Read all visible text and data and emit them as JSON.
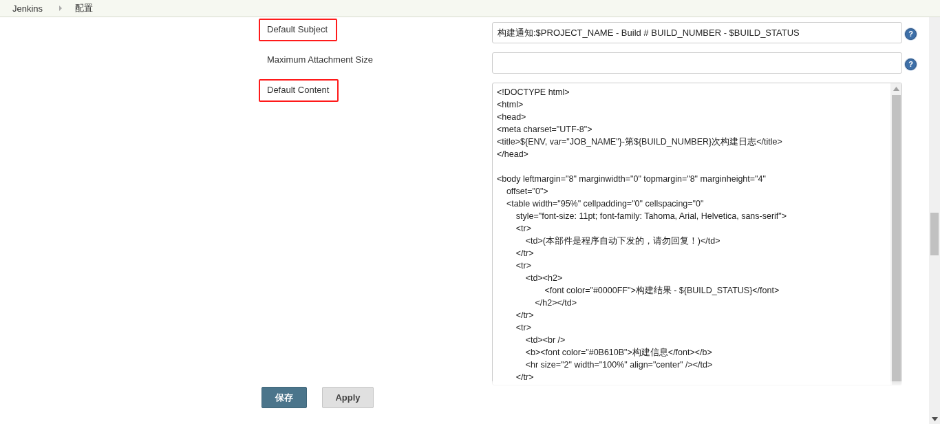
{
  "breadcrumb": [
    "Jenkins",
    "配置"
  ],
  "fields": [
    {
      "kind": "text",
      "label": "Default Subject",
      "highlighted": true,
      "value": "构建通知:$PROJECT_NAME - Build # BUILD_NUMBER - $BUILD_STATUS",
      "help": "?"
    },
    {
      "kind": "text",
      "label": "Maximum Attachment Size",
      "highlighted": false,
      "help": "?"
    },
    {
      "kind": "textarea",
      "label": "Default Content",
      "highlighted": true,
      "value": "<!DOCTYPE html>\n<html>\n<head>\n<meta charset=\"UTF-8\">\n<title>${ENV, var=\"JOB_NAME\"}-第${BUILD_NUMBER}次构建日志</title>\n</head>\n\n<body leftmargin=\"8\" marginwidth=\"0\" topmargin=\"8\" marginheight=\"4\"\n    offset=\"0\">\n    <table width=\"95%\" cellpadding=\"0\" cellspacing=\"0\"\n        style=\"font-size: 11pt; font-family: Tahoma, Arial, Helvetica, sans-serif\">\n        <tr>\n            <td>(本部件是程序自动下发的，请勿回复！)</td>\n        </tr>\n        <tr>\n            <td><h2>\n                    <font color=\"#0000FF\">构建结果 - ${BUILD_STATUS}</font>\n                </h2></td>\n        </tr>\n        <tr>\n            <td><br />\n            <b><font color=\"#0B610B\">构建信息</font></b>\n            <hr size=\"2\" width=\"100%\" align=\"center\" /></td>\n        </tr>"
    }
  ],
  "buttons": [
    {
      "kind": "primary",
      "label": "保存"
    },
    {
      "kind": "secondary",
      "label": "Apply"
    }
  ]
}
